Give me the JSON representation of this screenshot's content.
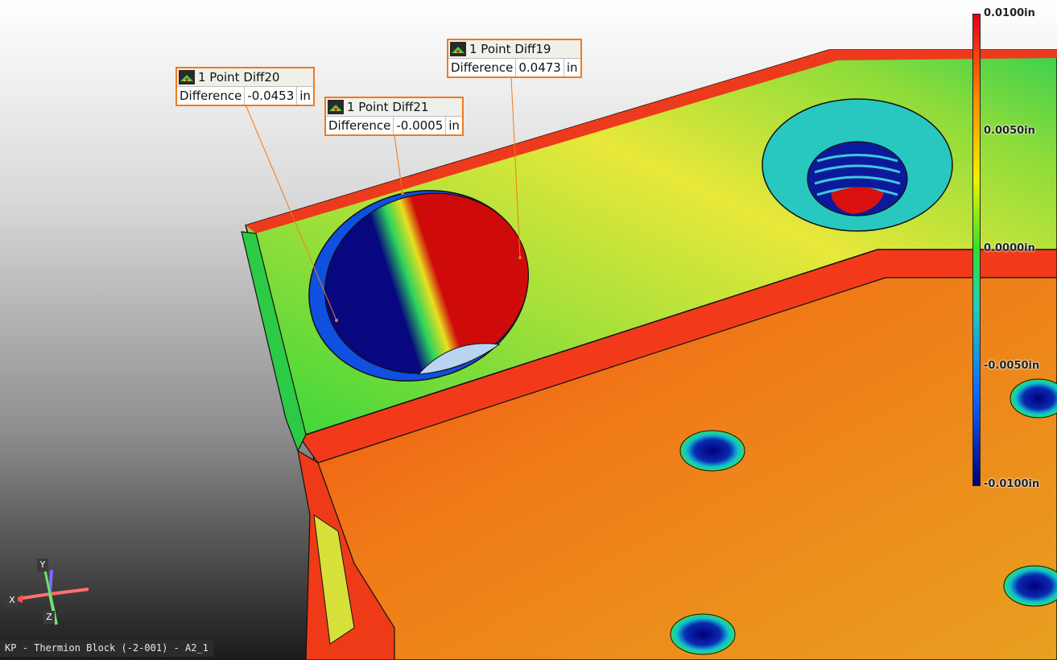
{
  "viewport_label": "KP - Thermion Block (-2-001) - A2_1",
  "callouts": [
    {
      "title": "1 Point Diff20",
      "label": "Difference",
      "value": "-0.0453",
      "unit": "in",
      "icon": "inspection-icon"
    },
    {
      "title": "1 Point Diff21",
      "label": "Difference",
      "value": "-0.0005",
      "unit": "in",
      "icon": "inspection-icon"
    },
    {
      "title": "1 Point Diff19",
      "label": "Difference",
      "value": "0.0473",
      "unit": "in",
      "icon": "inspection-icon"
    }
  ],
  "colorbar": {
    "ticks": [
      "0.0100in",
      "0.0050in",
      "0.0000in",
      "-0.0050in",
      "-0.0100in"
    ],
    "colors": [
      "#e8001c",
      "#ff8a00",
      "#f2f200",
      "#2fe02f",
      "#1060ff",
      "#00007a"
    ]
  },
  "axes": {
    "x": "X",
    "y": "Y",
    "z": "Z"
  }
}
